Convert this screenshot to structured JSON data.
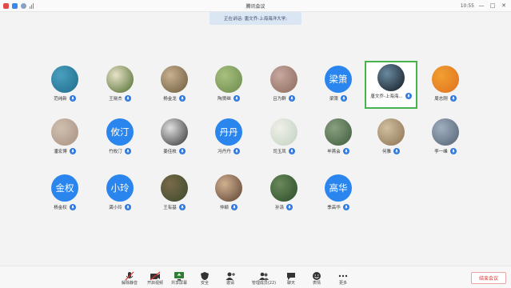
{
  "window": {
    "title": "腾讯会议",
    "clock": "10:55"
  },
  "speaking_banner": "正在讲话: 唐文乔-上海海洋大学;",
  "participants": [
    {
      "name": "范纯新",
      "avatar_type": "photo",
      "colors": [
        "#1e6a8a",
        "#4aa0c0"
      ]
    },
    {
      "name": "王晓杰",
      "avatar_type": "photo",
      "colors": [
        "#4a6a2a",
        "#e8e2c8"
      ]
    },
    {
      "name": "杨金龙",
      "avatar_type": "photo",
      "colors": [
        "#6a5a3a",
        "#c8b090"
      ]
    },
    {
      "name": "陶贤继",
      "avatar_type": "photo",
      "colors": [
        "#6a8a4a",
        "#a8c080"
      ]
    },
    {
      "name": "吕为群",
      "avatar_type": "photo",
      "colors": [
        "#8a6a5a",
        "#c8a8a0"
      ]
    },
    {
      "name": "梁箫",
      "avatar_type": "text",
      "text": "梁箫"
    },
    {
      "name": "唐文乔-上海海...",
      "avatar_type": "photo",
      "colors": [
        "#101820",
        "#6a8aa0"
      ],
      "speaking": true
    },
    {
      "name": "周志刚",
      "avatar_type": "photo",
      "colors": [
        "#e07020",
        "#f0a030"
      ]
    },
    {
      "name": "潘宏博",
      "avatar_type": "photo",
      "colors": [
        "#a89080",
        "#d0c0b0"
      ]
    },
    {
      "name": "竹攸汀",
      "avatar_type": "text",
      "text": "攸汀"
    },
    {
      "name": "姜佳枚",
      "avatar_type": "photo",
      "colors": [
        "#303030",
        "#e0e0e0"
      ]
    },
    {
      "name": "冯丹丹",
      "avatar_type": "text",
      "text": "丹丹"
    },
    {
      "name": "司玉凤",
      "avatar_type": "photo",
      "colors": [
        "#c0d0c0",
        "#f0f0e8"
      ]
    },
    {
      "name": "毕燕会",
      "avatar_type": "photo",
      "colors": [
        "#3a5a3a",
        "#8aa080"
      ]
    },
    {
      "name": "何雅",
      "avatar_type": "photo",
      "colors": [
        "#8a7050",
        "#d0c0a0"
      ]
    },
    {
      "name": "李一峰",
      "avatar_type": "photo",
      "colors": [
        "#506070",
        "#a0b0c0"
      ]
    },
    {
      "name": "杨金权",
      "avatar_type": "text",
      "text": "金权"
    },
    {
      "name": "龚小玲",
      "avatar_type": "text",
      "text": "小玲"
    },
    {
      "name": "王有基",
      "avatar_type": "photo",
      "colors": [
        "#3a4a2a",
        "#7a6a4a"
      ]
    },
    {
      "name": "仲颖",
      "avatar_type": "photo",
      "colors": [
        "#5a4030",
        "#d0b090"
      ]
    },
    {
      "name": "孙涤",
      "avatar_type": "photo",
      "colors": [
        "#2a4a2a",
        "#6a8a5a"
      ]
    },
    {
      "name": "季高华",
      "avatar_type": "text",
      "text": "高华"
    }
  ],
  "toolbar": [
    {
      "label": "解除静音",
      "icon": "mic-muted-icon"
    },
    {
      "label": "开启视频",
      "icon": "video-off-icon"
    },
    {
      "label": "共享屏幕",
      "icon": "share-screen-icon"
    },
    {
      "label": "安全",
      "icon": "shield-icon"
    },
    {
      "label": "邀请",
      "icon": "invite-icon"
    },
    {
      "label": "管理成员(22)",
      "icon": "members-icon"
    },
    {
      "label": "聊天",
      "icon": "chat-icon"
    },
    {
      "label": "表情",
      "icon": "emoji-icon"
    },
    {
      "label": "更多",
      "icon": "more-icon"
    }
  ],
  "end_button": "结束会议",
  "colors": {
    "accent": "#2a86ee",
    "speaker_border": "#47b34d",
    "end": "#d33333"
  }
}
